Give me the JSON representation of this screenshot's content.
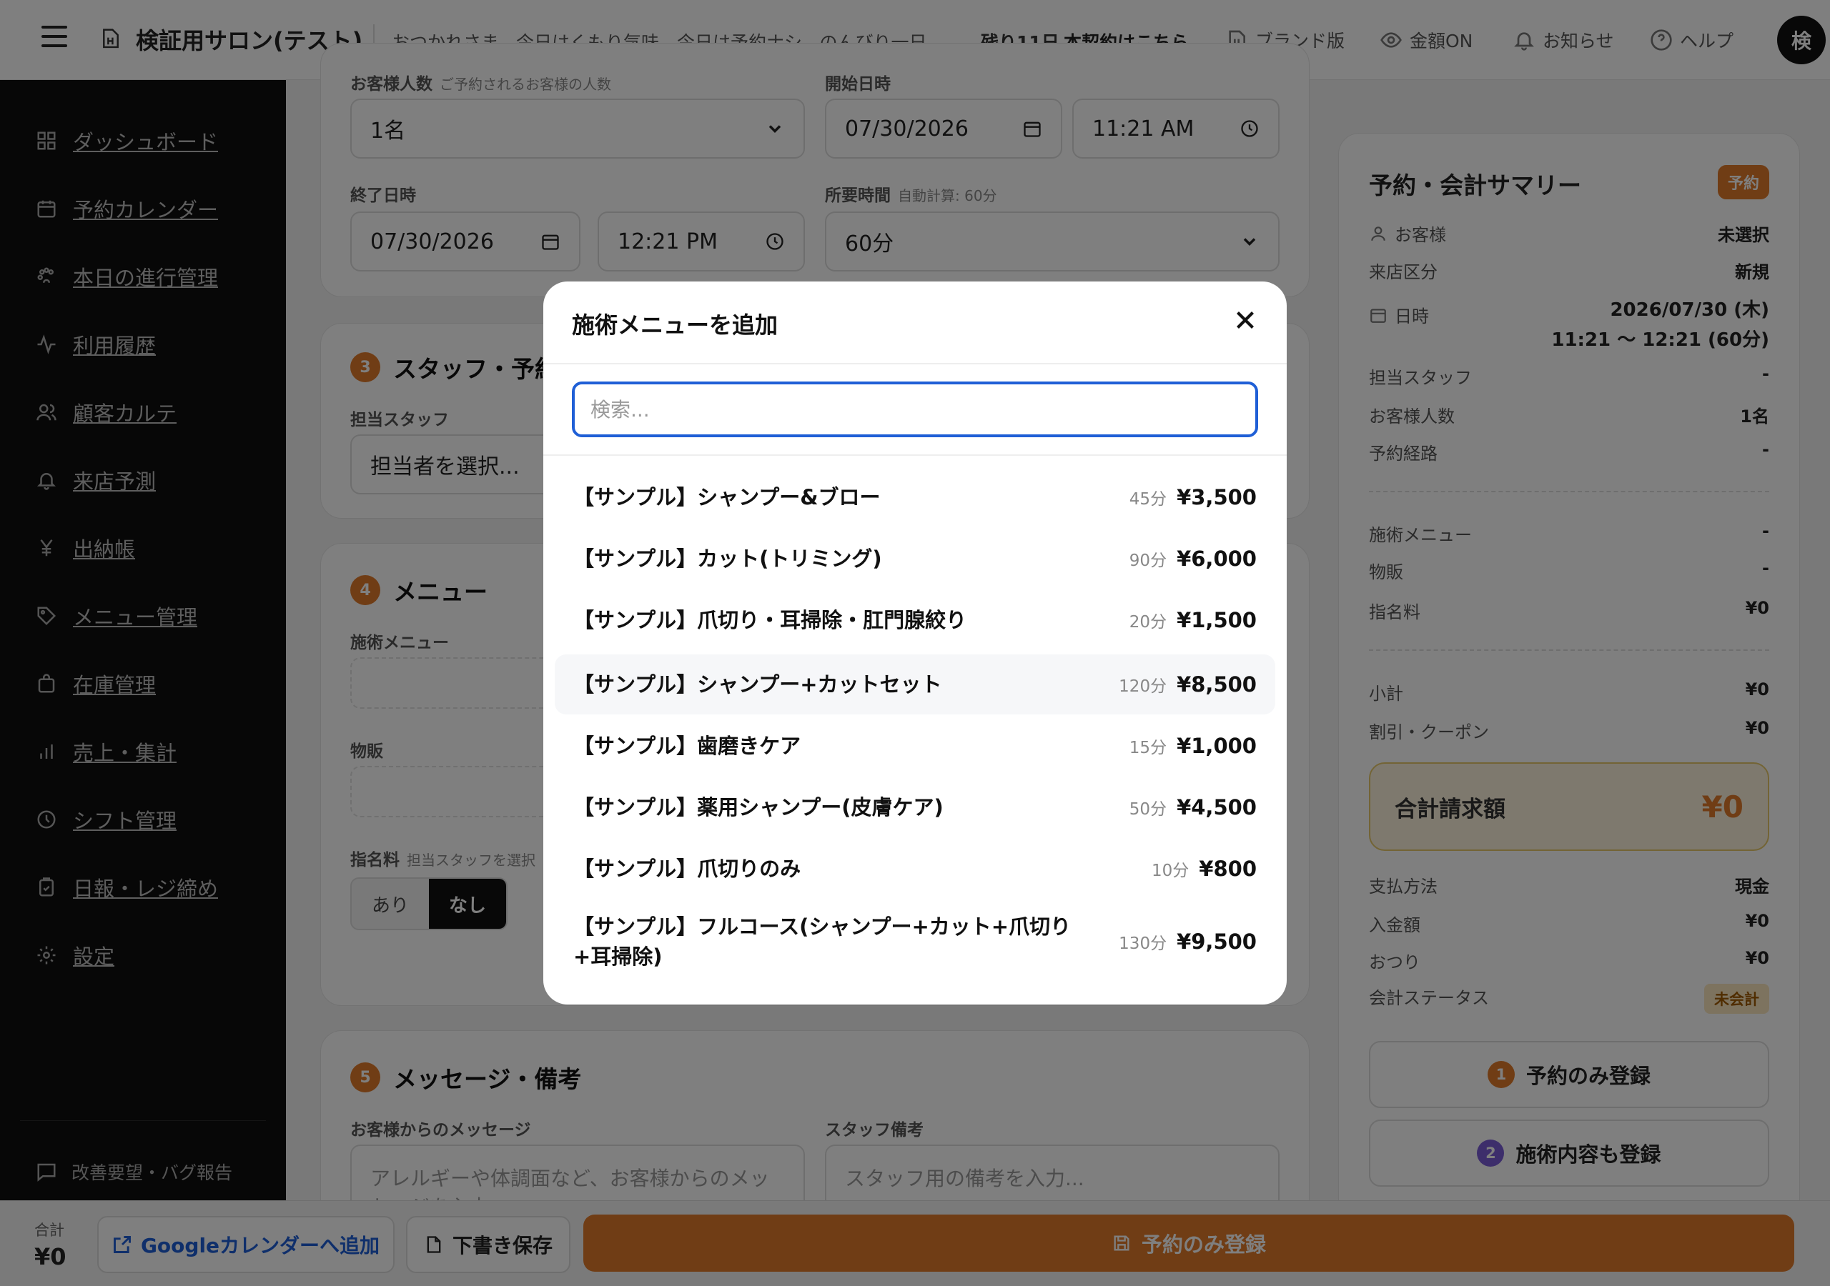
{
  "header": {
    "salon_name": "検証用サロン(テスト)",
    "greeting": "おつかれさま。今日はくもり気味。今日は予約ナシ、のんびり一日。",
    "trial_days_left": "残り11日",
    "trial_link": "本契約はこちら",
    "brand_version": "ブランド版",
    "amount_toggle": "金額ON",
    "notifications": "お知らせ",
    "help": "ヘルプ",
    "avatar_initial": "検"
  },
  "sidebar": {
    "items": [
      {
        "label": "ダッシュボード",
        "icon": "dashboard-icon"
      },
      {
        "label": "予約カレンダー",
        "icon": "calendar-icon"
      },
      {
        "label": "本日の進行管理",
        "icon": "paw-icon"
      },
      {
        "label": "利用履歴",
        "icon": "activity-icon"
      },
      {
        "label": "顧客カルテ",
        "icon": "users-icon"
      },
      {
        "label": "来店予測",
        "icon": "bell-icon"
      },
      {
        "label": "出納帳",
        "icon": "yen-icon"
      },
      {
        "label": "メニュー管理",
        "icon": "tag-icon"
      },
      {
        "label": "在庫管理",
        "icon": "bag-icon"
      },
      {
        "label": "売上・集計",
        "icon": "bar-chart-icon"
      },
      {
        "label": "シフト管理",
        "icon": "clock-icon"
      },
      {
        "label": "日報・レジ締め",
        "icon": "clipboard-icon"
      },
      {
        "label": "設定",
        "icon": "gear-icon"
      }
    ],
    "feedback": "改善要望・バグ報告"
  },
  "form": {
    "guests_label": "お客様人数",
    "guests_sub": "ご予約されるお客様の人数",
    "guests_value": "1名",
    "start_label": "開始日時",
    "start_date": "07/30/2026",
    "start_time": "11:21 AM",
    "end_label": "終了日時",
    "end_date": "07/30/2026",
    "end_time": "12:21 PM",
    "duration_label": "所要時間",
    "duration_sub": "自動計算: 60分",
    "duration_value": "60分",
    "section3_num": "3",
    "section3_title": "スタッフ・予約",
    "staff_label": "担当スタッフ",
    "staff_value": "担当者を選択...",
    "section4_num": "4",
    "section4_title": "メニュー",
    "treatment_label": "施術メニュー",
    "product_label": "物販",
    "nomination_label": "指名料",
    "nomination_sub": "担当スタッフを選択",
    "toggle_yes": "あり",
    "toggle_no": "なし",
    "section5_num": "5",
    "section5_title": "メッセージ・備考",
    "customer_msg_label": "お客様からのメッセージ",
    "customer_msg_placeholder": "アレルギーや体調面など、お客様からのメッセージを入力...",
    "staff_note_label": "スタッフ備考",
    "staff_note_placeholder": "スタッフ用の備考を入力..."
  },
  "summary": {
    "title": "予約・会計サマリー",
    "badge": "予約",
    "customer_label": "お客様",
    "customer_value": "未選択",
    "visit_type_label": "来店区分",
    "visit_type_value": "新規",
    "datetime_label": "日時",
    "datetime_line1": "2026/07/30 (木)",
    "datetime_line2": "11:21 〜 12:21 (60分)",
    "staff_label": "担当スタッフ",
    "staff_value": "-",
    "guests_label": "お客様人数",
    "guests_value": "1名",
    "route_label": "予約経路",
    "route_value": "-",
    "treatment_label": "施術メニュー",
    "treatment_value": "-",
    "product_label": "物販",
    "product_value": "-",
    "nomination_label": "指名料",
    "nomination_value": "¥0",
    "subtotal_label": "小計",
    "subtotal_value": "¥0",
    "discount_label": "割引・クーポン",
    "discount_value": "¥0",
    "total_label": "合計請求額",
    "total_value": "¥0",
    "payment_label": "支払方法",
    "payment_value": "現金",
    "received_label": "入金額",
    "received_value": "¥0",
    "change_label": "おつり",
    "change_value": "¥0",
    "status_label": "会計ステータス",
    "status_value": "未会計",
    "btn1_num": "1",
    "btn1_label": "予約のみ登録",
    "btn2_num": "2",
    "btn2_label": "施術内容も登録"
  },
  "bottom": {
    "total_label": "合計",
    "total_value": "¥0",
    "google_btn": "Googleカレンダーへ追加",
    "draft_btn": "下書き保存",
    "primary_btn": "予約のみ登録"
  },
  "modal": {
    "title": "施術メニューを追加",
    "search_placeholder": "検索...",
    "items": [
      {
        "name": "【サンプル】シャンプー&ブロー",
        "duration": "45分",
        "price": "¥3,500"
      },
      {
        "name": "【サンプル】カット(トリミング)",
        "duration": "90分",
        "price": "¥6,000"
      },
      {
        "name": "【サンプル】爪切り・耳掃除・肛門腺絞り",
        "duration": "20分",
        "price": "¥1,500"
      },
      {
        "name": "【サンプル】シャンプー+カットセット",
        "duration": "120分",
        "price": "¥8,500"
      },
      {
        "name": "【サンプル】歯磨きケア",
        "duration": "15分",
        "price": "¥1,000"
      },
      {
        "name": "【サンプル】薬用シャンプー(皮膚ケア)",
        "duration": "50分",
        "price": "¥4,500"
      },
      {
        "name": "【サンプル】爪切りのみ",
        "duration": "10分",
        "price": "¥800"
      },
      {
        "name": "【サンプル】フルコース(シャンプー+カット+爪切り+耳掃除)",
        "duration": "130分",
        "price": "¥9,500"
      }
    ]
  },
  "colors": {
    "accent": "#e07b2b",
    "focus": "#1f5fd6",
    "sidebar_bg": "#0e0e0e",
    "total_box_bg": "#fdf3dc"
  }
}
